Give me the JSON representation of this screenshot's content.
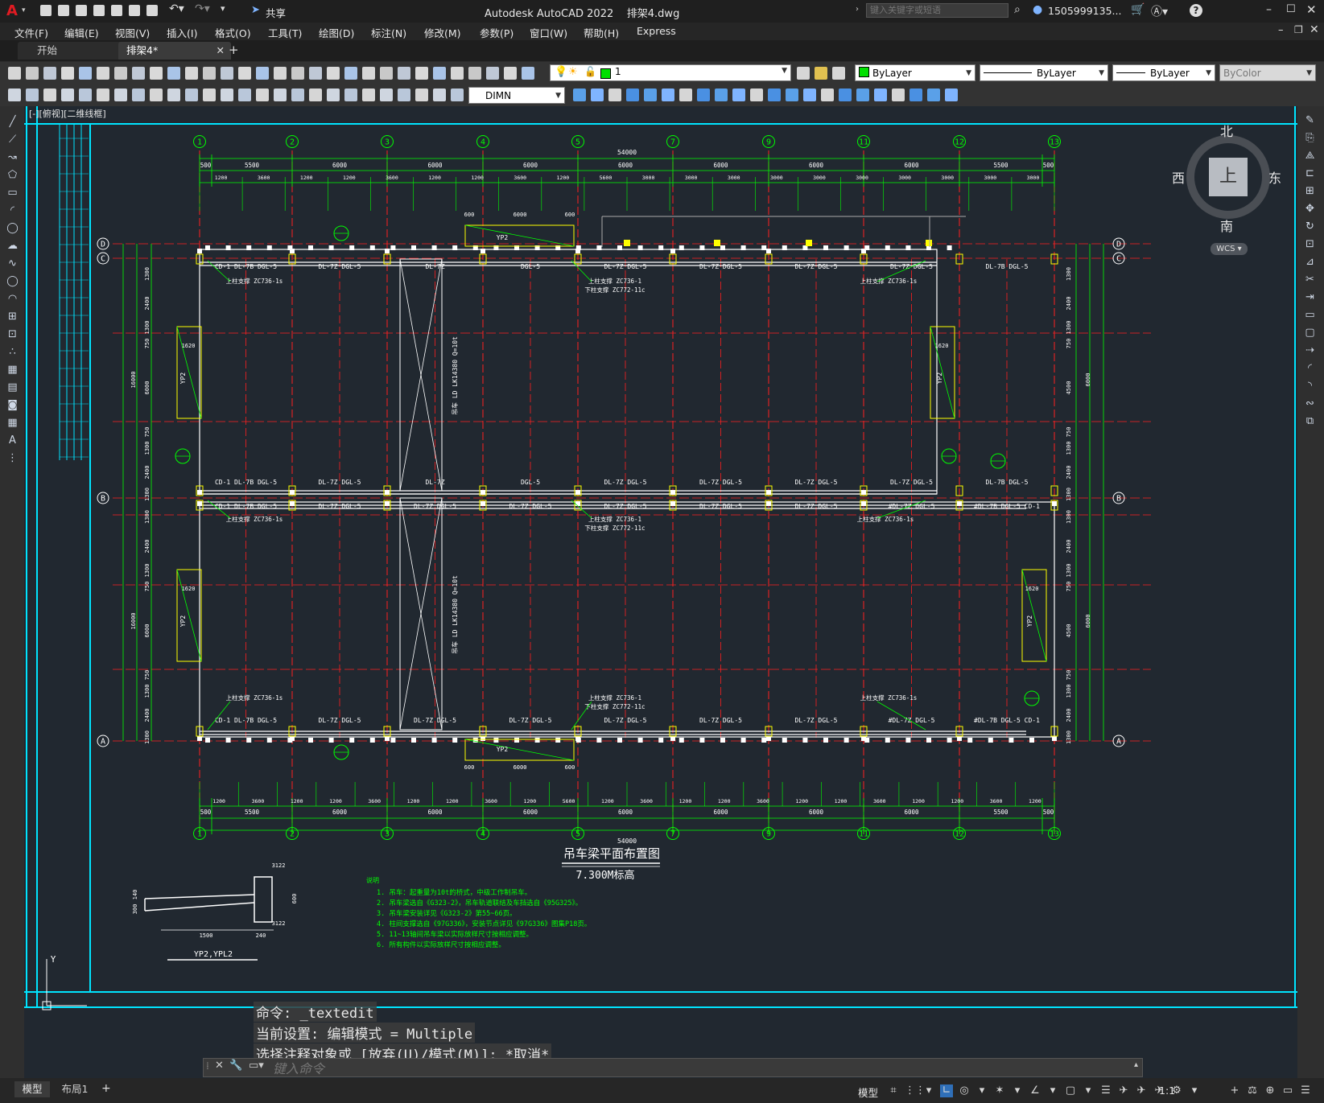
{
  "app": {
    "title": "Autodesk AutoCAD 2022    排架4.dwg",
    "share": "共享",
    "search_placeholder": "键入关键字或短语",
    "user": "1505999135...",
    "help": "?"
  },
  "menu": [
    "文件(F)",
    "编辑(E)",
    "视图(V)",
    "插入(I)",
    "格式(O)",
    "工具(T)",
    "绘图(D)",
    "标注(N)",
    "修改(M)",
    "参数(P)",
    "窗口(W)",
    "帮助(H)",
    "Express"
  ],
  "tabs": [
    {
      "label": "开始"
    },
    {
      "label": "排架4*"
    }
  ],
  "toolbar": {
    "layer_value": "1",
    "color_value": "ByLayer",
    "linetype_value": "ByLayer",
    "lineweight_value": "ByLayer",
    "plotstyle_value": "ByColor",
    "dimstyle_value": "DIMN"
  },
  "viewport_label": "[-][俯视][二维线框]",
  "viewcube": {
    "north": "北",
    "south": "南",
    "west": "西",
    "east": "东",
    "top": "上",
    "wcs": "WCS"
  },
  "drawing": {
    "grid_numbers": [
      "1",
      "2",
      "3",
      "4",
      "5",
      "7",
      "9",
      "11",
      "12",
      "13"
    ],
    "row_letters_left": [
      "D",
      "C",
      "B",
      "A"
    ],
    "total_length": "54000",
    "top_spans": [
      "500",
      "5500",
      "6000",
      "6000",
      "6000",
      "6000",
      "6000",
      "6000",
      "6000",
      "5500",
      "500"
    ],
    "top_sub_spans": [
      "1200",
      "3600",
      "1200",
      "1200",
      "3600",
      "1200",
      "1200",
      "3600",
      "1200",
      "5600",
      "3000",
      "3000",
      "3000",
      "3000",
      "3000",
      "3000",
      "3000",
      "3000",
      "3000",
      "3000"
    ],
    "bottom_spans": [
      "500",
      "5500",
      "6000",
      "6000",
      "6000",
      "6000",
      "6000",
      "6000",
      "6000",
      "5500",
      "500"
    ],
    "bottom_sub_spans": [
      "1200",
      "3600",
      "1200",
      "1200",
      "3600",
      "1200",
      "1200",
      "3600",
      "1200",
      "5600",
      "1200",
      "3600",
      "1200",
      "1200",
      "3600",
      "1200",
      "1200",
      "3600",
      "1200",
      "1200",
      "3600",
      "1200"
    ],
    "left_dims": [
      "1300",
      "2400",
      "1300",
      "750",
      "6000",
      "750",
      "1300",
      "2400",
      "1300"
    ],
    "left_totals": [
      "5000",
      "16000",
      "5000"
    ],
    "right_dims": [
      "1300",
      "2400",
      "1300",
      "750",
      "4500",
      "750",
      "1300",
      "2400",
      "1300"
    ],
    "right_totals": [
      "5000",
      "6000",
      "5000"
    ],
    "beam_labels_row_c": [
      "CD-1 DL-7B DGL-5",
      "DL-7Z DGL-5",
      "DL-7Z",
      "DGL-5",
      "DL-7Z DGL-5",
      "DL-7Z DGL-5",
      "DL-7Z DGL-5",
      "DL-7Z DGL-5",
      "DL-7B DGL-5"
    ],
    "beam_labels_row_b1": [
      "CD-1 DL-7B DGL-5",
      "DL-7Z DGL-5",
      "DL-7Z",
      "DGL-5",
      "DL-7Z DGL-5",
      "DL-7Z DGL-5",
      "DL-7Z DGL-5",
      "DL-7Z DGL-5",
      "DL-7B DGL-5"
    ],
    "beam_labels_row_b2": [
      "CD-1 DL-7B DGL-5",
      "DL-7Z DGL-5",
      "DL-7Z DGL-5",
      "DL-7Z DGL-5",
      "DL-7Z DGL-5",
      "DL-7Z DGL-5",
      "DL-7Z DGL-5",
      "#DL-7Z DGL-5",
      "#DL-7B DGL-5 CD-1"
    ],
    "beam_labels_row_a": [
      "CD-1 DL-7B DGL-5",
      "DL-7Z DGL-5",
      "DL-7Z DGL-5",
      "DL-7Z DGL-5",
      "DL-7Z DGL-5",
      "DL-7Z DGL-5",
      "DL-7Z DGL-5",
      "#DL-7Z DGL-5",
      "#DL-7B DGL-5 CD-1"
    ],
    "brace_upper": "上柱支撑 ZC736-1s",
    "brace_upper_mid": "上柱支撑 ZC736-1",
    "brace_lower_mid": "下柱支撑 ZC772-11c",
    "crane_note": "吊车 LD LK14380 Q=10t",
    "yp_label": "YP2",
    "yp_dims": [
      "600",
      "6000",
      "600",
      "1620"
    ],
    "drawing_title": "吊车梁平面布置图",
    "drawing_subtitle": "7.300M标高",
    "detail_label": "YP2,YPL2",
    "detail_dims": [
      "1500",
      "240",
      "3122",
      "600",
      "3122",
      "300",
      "140"
    ],
    "notes_title": "说明",
    "notes": [
      "1. 吊车：起重量为10t的桥式，中级工作制吊车。",
      "2. 吊车梁选自《G323-2》，吊车轨道联结及车挡选自《95G325》。",
      "3. 吊车梁安装详见《G323-2》第55~66页。",
      "4. 柱间支撑选自《97G336》，安装节点详见《97G336》图集P18页。",
      "5. 11~13轴间吊车梁以实际放样尺寸按相应调整。",
      "6. 所有构件以实际放样尺寸按相应调整。"
    ]
  },
  "command": {
    "history1": "命令: _textedit",
    "history2": "当前设置: 编辑模式 = Multiple",
    "history3": "选择注释对象或 [放弃(U)/模式(M)]: *取消*",
    "input_placeholder": "键入命令"
  },
  "status": {
    "layout_tabs": [
      "模型",
      "布局1"
    ],
    "model_label": "模型",
    "scale": "1:1"
  },
  "colors": {
    "grid_red": "#ff2020",
    "dim_green": "#00ff00",
    "white": "#ffffff",
    "cyan": "#00e5ff",
    "yellow": "#ffff00",
    "bg": "#212830"
  }
}
